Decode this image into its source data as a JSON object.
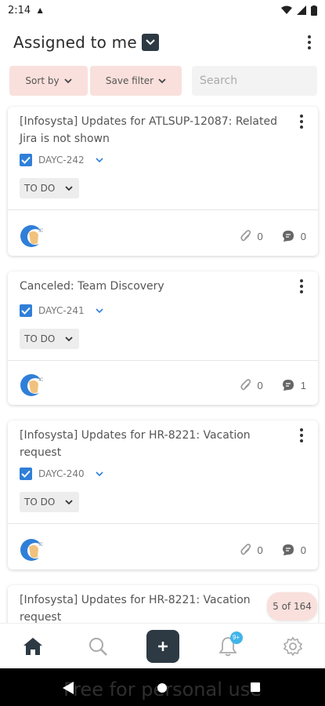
{
  "status_bar": {
    "time": "2:14"
  },
  "header": {
    "title": "Assigned to me"
  },
  "filters": {
    "sort_label": "Sort by",
    "save_label": "Save filter",
    "search_placeholder": "Search"
  },
  "cards": [
    {
      "title": "[Infosysta] Updates for ATLSUP-12087: Related Jira is not shown",
      "key": "DAYC-242",
      "status": "TO DO",
      "attachments": "0",
      "comments": "0"
    },
    {
      "title": "Canceled: Team Discovery",
      "key": "DAYC-241",
      "status": "TO DO",
      "attachments": "0",
      "comments": "1"
    },
    {
      "title": "[Infosysta] Updates for HR-8221: Vacation request",
      "key": "DAYC-240",
      "status": "TO DO",
      "attachments": "0",
      "comments": "0"
    },
    {
      "title": "[Infosysta] Updates for HR-8221: Vacation request"
    }
  ],
  "pager": {
    "text": "5 of 164"
  },
  "bottom_nav": {
    "notification_badge": "9+"
  },
  "watermark": "Free for personal use",
  "colors": {
    "accent": "#2d3a44",
    "chip_bg": "#f9e0dc",
    "checkbox": "#2f7fd8",
    "badge": "#3fb5e9"
  }
}
